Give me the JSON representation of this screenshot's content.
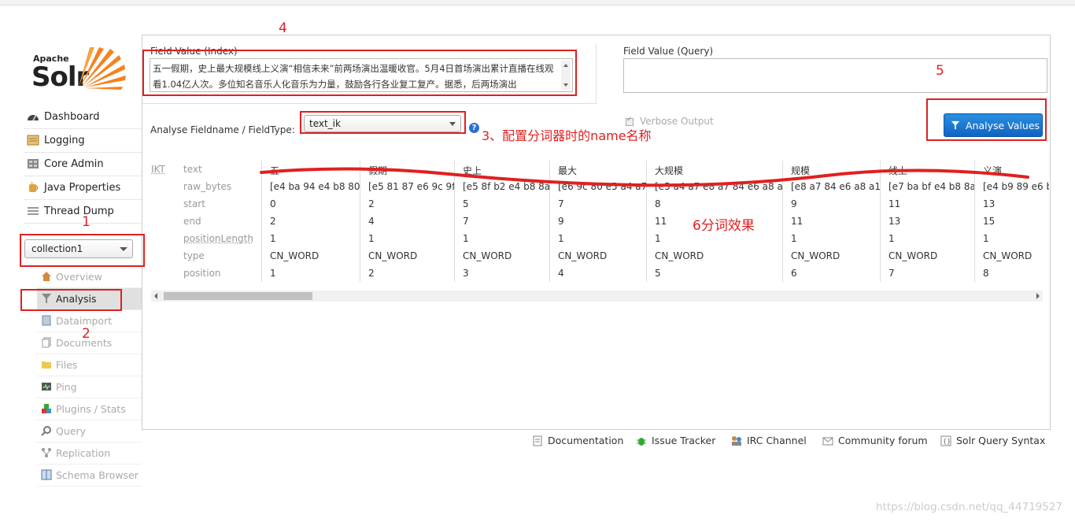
{
  "app": {
    "logo_apache": "Apache",
    "logo_solr": "Solr"
  },
  "sidebar": {
    "items": [
      {
        "label": "Dashboard",
        "icon": "dashboard-icon"
      },
      {
        "label": "Logging",
        "icon": "logging-icon"
      },
      {
        "label": "Core Admin",
        "icon": "core-admin-icon"
      },
      {
        "label": "Java Properties",
        "icon": "java-icon"
      },
      {
        "label": "Thread Dump",
        "icon": "thread-dump-icon"
      }
    ],
    "core_selector": "collection1",
    "core_items": [
      {
        "label": "Overview",
        "icon": "home-icon"
      },
      {
        "label": "Analysis",
        "icon": "filter-icon"
      },
      {
        "label": "Dataimport",
        "icon": "dataimport-icon"
      },
      {
        "label": "Documents",
        "icon": "documents-icon"
      },
      {
        "label": "Files",
        "icon": "folder-icon"
      },
      {
        "label": "Ping",
        "icon": "ping-icon"
      },
      {
        "label": "Plugins / Stats",
        "icon": "plugins-icon"
      },
      {
        "label": "Query",
        "icon": "search-icon"
      },
      {
        "label": "Replication",
        "icon": "replication-icon"
      },
      {
        "label": "Schema Browser",
        "icon": "schema-icon"
      }
    ]
  },
  "form": {
    "index_label": "Field Value (Index)",
    "index_value": "五一假期，史上最大规模线上义演“相信未来”前两场演出温暖收官。5月4日首场演出累计直播在线观看1.04亿人次。多位知名音乐人化音乐为力量，鼓励各行各业复工复产。据悉，后两场演出",
    "query_label": "Field Value (Query)",
    "query_value": "",
    "fieldtype_label": "Analyse Fieldname / FieldType:",
    "fieldtype_value": "text_ik",
    "help": "?",
    "verbose_label": "Verbose Output",
    "analyse_button": "Analyse Values"
  },
  "analysis": {
    "tokenizer": "IKT",
    "row_labels": [
      "text",
      "raw_bytes",
      "start",
      "end",
      "positionLength",
      "type",
      "position"
    ],
    "tokens": [
      {
        "text": "五一",
        "raw_bytes": "[e4 ba 94 e4 b8 80]",
        "start": "0",
        "end": "2",
        "positionLength": "1",
        "type": "CN_WORD",
        "position": "1"
      },
      {
        "text": "假期",
        "raw_bytes": "[e5 81 87 e6 9c 9f]",
        "start": "2",
        "end": "4",
        "positionLength": "1",
        "type": "CN_WORD",
        "position": "2"
      },
      {
        "text": "史上",
        "raw_bytes": "[e5 8f b2 e4 b8 8a]",
        "start": "5",
        "end": "7",
        "positionLength": "1",
        "type": "CN_WORD",
        "position": "3"
      },
      {
        "text": "最大",
        "raw_bytes": "[e6 9c 80 e5 a4 a7]",
        "start": "7",
        "end": "9",
        "positionLength": "1",
        "type": "CN_WORD",
        "position": "4"
      },
      {
        "text": "大规模",
        "raw_bytes": "[e5 a4 a7 e8 a7 84 e6 a8 a1]",
        "start": "8",
        "end": "11",
        "positionLength": "1",
        "type": "CN_WORD",
        "position": "5"
      },
      {
        "text": "规模",
        "raw_bytes": "[e8 a7 84 e6 a8 a1]",
        "start": "9",
        "end": "11",
        "positionLength": "1",
        "type": "CN_WORD",
        "position": "6"
      },
      {
        "text": "线上",
        "raw_bytes": "[e7 ba bf e4 b8 8a]",
        "start": "11",
        "end": "13",
        "positionLength": "1",
        "type": "CN_WORD",
        "position": "7"
      },
      {
        "text": "义演",
        "raw_bytes": "[e4 b9 89 e6 b",
        "start": "13",
        "end": "15",
        "positionLength": "1",
        "type": "CN_WORD",
        "position": "8"
      }
    ]
  },
  "footer": {
    "links": [
      {
        "label": "Documentation",
        "icon": "document-icon"
      },
      {
        "label": "Issue Tracker",
        "icon": "bug-icon"
      },
      {
        "label": "IRC Channel",
        "icon": "irc-icon"
      },
      {
        "label": "Community forum",
        "icon": "mail-icon"
      },
      {
        "label": "Solr Query Syntax",
        "icon": "syntax-icon"
      }
    ]
  },
  "watermark": "https://blog.csdn.net/qq_44719527",
  "annotations": {
    "n1": "1",
    "n2": "2",
    "n3": "3、配置分词器时的name名称",
    "n4": "4",
    "n5": "5",
    "n6": "6分词效果"
  },
  "colors": {
    "accent": "#1a73d0",
    "annotation": "#e02020"
  }
}
